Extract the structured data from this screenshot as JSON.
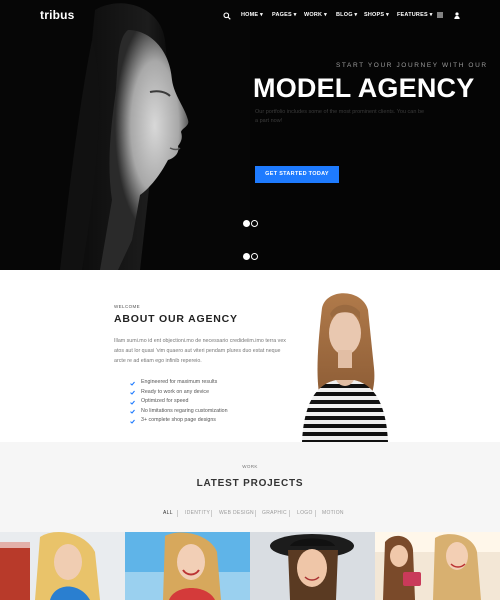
{
  "header": {
    "logo": "tribus",
    "nav": [
      "HOME",
      "PAGES",
      "WORK",
      "BLOG",
      "SHOPS",
      "FEATURES"
    ],
    "icons": [
      "search-icon",
      "menu-icon",
      "user-icon"
    ]
  },
  "hero": {
    "kicker": "START YOUR JOURNEY WITH OUR",
    "title": "MODEL AGENCY",
    "description": "Our portfolio includes some of the most prominent clients. You can be a part now!",
    "cta": "GET STARTED TODAY",
    "slides_total": 2,
    "active_slide": 1
  },
  "about": {
    "kicker": "WELCOME",
    "title": "ABOUT OUR AGENCY",
    "text": "Illam sumi.mo id ent objectioni.mo de necessario credideiim.imo terra vex atos aut lor quasi 'vim quaero aut viteri pendam plures duo estat neque arcte re ad etiam ego infinib repereio.",
    "features": [
      "Engineered for maximum results",
      "Ready to work on any device",
      "Optimized for speed",
      "No limitations regaring customization",
      "3+ complete shop page designs"
    ]
  },
  "projects": {
    "kicker": "WORK",
    "title": "LATEST PROJECTS",
    "filters": [
      "ALL",
      "IDENTITY",
      "WEB DESIGN",
      "GRAPHIC",
      "LOGO",
      "MOTION"
    ],
    "active_filter": "ALL"
  },
  "colors": {
    "accent": "#1e7bff",
    "hero_bg": "#050505",
    "projects_bg": "#f6f6f6"
  }
}
